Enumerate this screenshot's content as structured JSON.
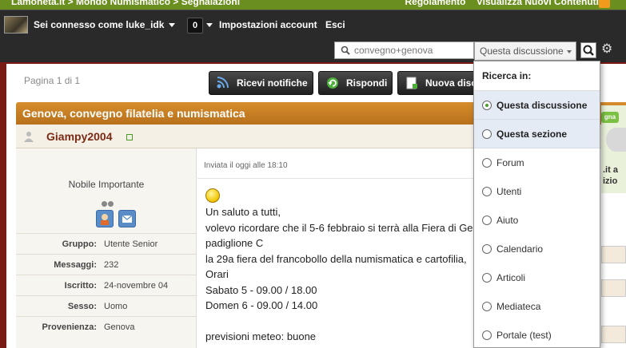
{
  "topbar": {
    "breadcrumb": "Lamoneta.it  > Mondo Numismatico  > Segnalazioni",
    "links": [
      "Regolamento",
      "Visualizza Nuovi Contenuti"
    ],
    "rss_icon": "rss-icon"
  },
  "userbar": {
    "connected_as": "Sei connesso come luke_idk",
    "notification_count": "0",
    "account_settings": "Impostazioni account",
    "logout": "Esci"
  },
  "search": {
    "query": "convegno+genova",
    "scope": "Questa discussione"
  },
  "dropdown": {
    "title": "Ricerca in:",
    "items": [
      {
        "label": "Questa discussione",
        "selected": true,
        "highlighted": true
      },
      {
        "label": "Questa sezione",
        "selected": false,
        "highlighted": true
      },
      {
        "label": "Forum",
        "selected": false,
        "highlighted": false
      },
      {
        "label": "Utenti",
        "selected": false,
        "highlighted": false
      },
      {
        "label": "Aiuto",
        "selected": false,
        "highlighted": false
      },
      {
        "label": "Calendario",
        "selected": false,
        "highlighted": false
      },
      {
        "label": "Articoli",
        "selected": false,
        "highlighted": false
      },
      {
        "label": "Mediateca",
        "selected": false,
        "highlighted": false
      },
      {
        "label": "Portale (test)",
        "selected": false,
        "highlighted": false
      }
    ]
  },
  "thread": {
    "pagination": "Pagina 1 di 1",
    "buttons": {
      "notify": "Ricevi notifiche",
      "reply": "Rispondi",
      "new_topic": "Nuova discu"
    },
    "title": "Genova, convegno filatelia e numismatica"
  },
  "post": {
    "username": "Giampy2004",
    "user_title": "Nobile Importante",
    "info": [
      {
        "key": "Gruppo:",
        "value": "Utente Senior"
      },
      {
        "key": "Messaggi:",
        "value": "232"
      },
      {
        "key": "Iscritto:",
        "value": "24-novembre 04"
      },
      {
        "key": "Sesso:",
        "value": "Uomo"
      },
      {
        "key": "Provenienza:",
        "value": "Genova"
      }
    ],
    "date": "Inviata il oggi alle 18:10",
    "lines": [
      "Un saluto a tutti,",
      "volevo ricordare che il 5-6 febbraio si terrà alla Fiera di Gen",
      "padiglione C",
      "la 29a fiera del francobollo della numismatica e cartofilia,",
      "Orari",
      "Sabato 5 - 09.00 / 18.00",
      "Domen 6 - 09.00 / 14.00",
      "",
      "previsioni meteo: buone"
    ]
  },
  "ad": {
    "badge": "gna",
    "text_line1": ".it a",
    "text_line2": "izio"
  }
}
